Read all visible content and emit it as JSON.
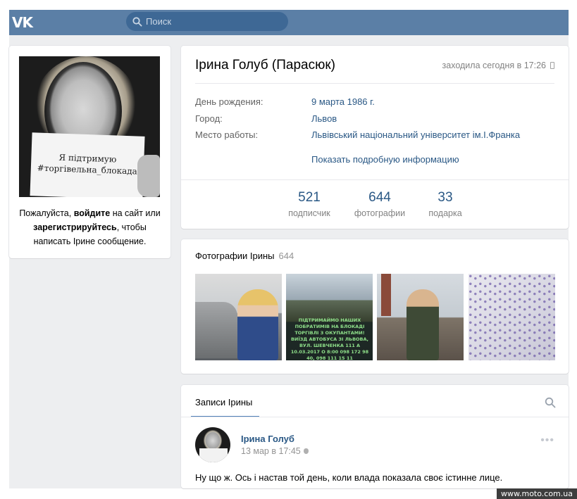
{
  "header": {
    "logo": "VK",
    "search_placeholder": "Поиск"
  },
  "left": {
    "avatar_sign_line1": "Я підтримую",
    "avatar_sign_line2": "#торгівельна_блокада",
    "msg_part1": "Пожалуйста, ",
    "msg_login": "войдите",
    "msg_part2": " на сайт или",
    "msg_register": "зарегистрируйтесь",
    "msg_part3": ", чтобы",
    "msg_part4": "написать Ірине сообщение."
  },
  "profile": {
    "name": "Ірина Голуб (Парасюк)",
    "last_seen": "заходила сегодня в 17:26",
    "info": [
      {
        "key": "День рождения:",
        "value": "9 марта 1986 г."
      },
      {
        "key": "Город:",
        "value": "Львов"
      },
      {
        "key": "Место работы:",
        "value": "Львівський національний університет ім.І.Франка"
      }
    ],
    "more": "Показать подробную информацию",
    "counters": [
      {
        "num": "521",
        "label": "подписчик"
      },
      {
        "num": "644",
        "label": "фотографии"
      },
      {
        "num": "33",
        "label": "подарка"
      }
    ]
  },
  "photos": {
    "title": "Фотографии Ірины",
    "count": "644",
    "photo2_text": "ПІДТРИМАЙМО НАШИХ ПОБРАТИМІВ НА БЛОКАДІ ТОРГІВЛІ З ОКУПАНТАМИ! ВИЇЗД АВТОБУСА ЗІ ЛЬВОВА, ВУЛ. ШЕВЧЕНКА 111 А 10.03.2017 О 8:00 098 172 98 40, 098 111 15 11"
  },
  "posts": {
    "tab": "Записи Ірины",
    "post": {
      "author": "Ірина Голуб",
      "date": "13 мар в 17:45",
      "text": "Ну що ж. Ось і настав той день, коли влада показала своє істинне лице."
    }
  },
  "watermark": "www.moto.com.ua"
}
